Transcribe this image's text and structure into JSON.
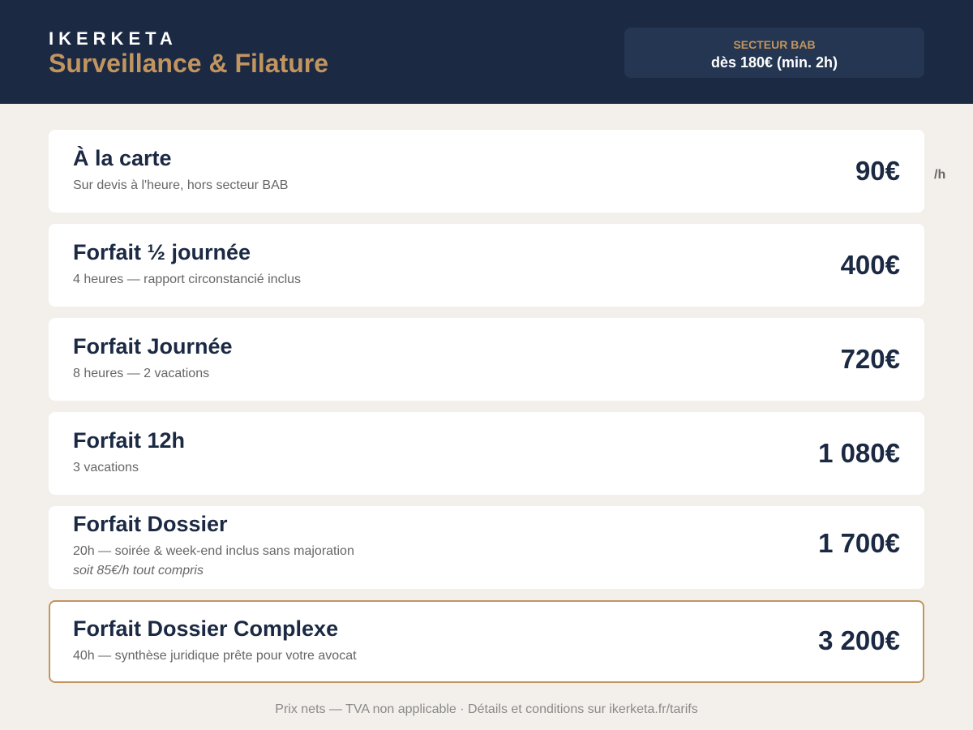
{
  "header": {
    "brand": "IKERKETA",
    "title": "Surveillance & Filature",
    "sector_label": "SECTEUR BAB",
    "sector_price": "dès 180€ (min. 2h)"
  },
  "colors": {
    "navy": "#1b2943",
    "gold": "#c1955f",
    "background": "#f3f0eb"
  },
  "offers": [
    {
      "title": "À la carte",
      "description": "Sur devis à l'heure, hors secteur BAB",
      "price": "90€",
      "unit": "/h"
    },
    {
      "title": "Forfait ½ journée",
      "description": "4 heures — rapport circonstancié inclus",
      "price": "400€"
    },
    {
      "title": "Forfait Journée",
      "description": "8 heures — 2 vacations",
      "price": "720€"
    },
    {
      "title": "Forfait 12h",
      "description": "3 vacations",
      "price": "1 080€"
    },
    {
      "title": "Forfait Dossier",
      "description": "20h — soirée & week-end inclus sans majoration",
      "note": "soit 85€/h tout compris",
      "price": "1 700€"
    },
    {
      "title": "Forfait Dossier Complexe",
      "description": "40h — synthèse juridique prête pour votre avocat",
      "price": "3 200€",
      "highlighted": true
    }
  ],
  "footer": {
    "text": "Prix nets — TVA non applicable · Détails et conditions sur ikerketa.fr/tarifs"
  }
}
